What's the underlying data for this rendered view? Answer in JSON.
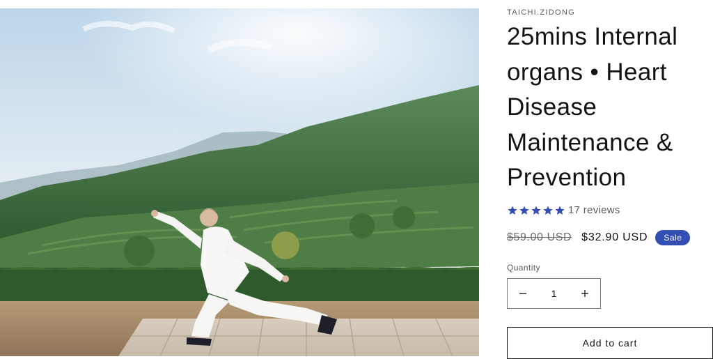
{
  "product": {
    "vendor": "TAICHI.ZIDONG",
    "title": "25mins Internal organs • Heart Disease Maintenance & Prevention",
    "rating": {
      "stars": 5,
      "reviews_text": "17 reviews"
    },
    "price": {
      "regular": "$59.00 USD",
      "sale": "$32.90 USD",
      "badge": "Sale"
    },
    "quantity": {
      "label": "Quantity",
      "value": "1",
      "minus_icon": "minus-icon",
      "plus_icon": "plus-icon"
    },
    "add_to_cart": "Add to cart",
    "image": {
      "subject": "tai-chi-practitioner-photo"
    }
  },
  "colors": {
    "star": "#334fb4",
    "badge": "#334fb4",
    "text": "#121212"
  }
}
